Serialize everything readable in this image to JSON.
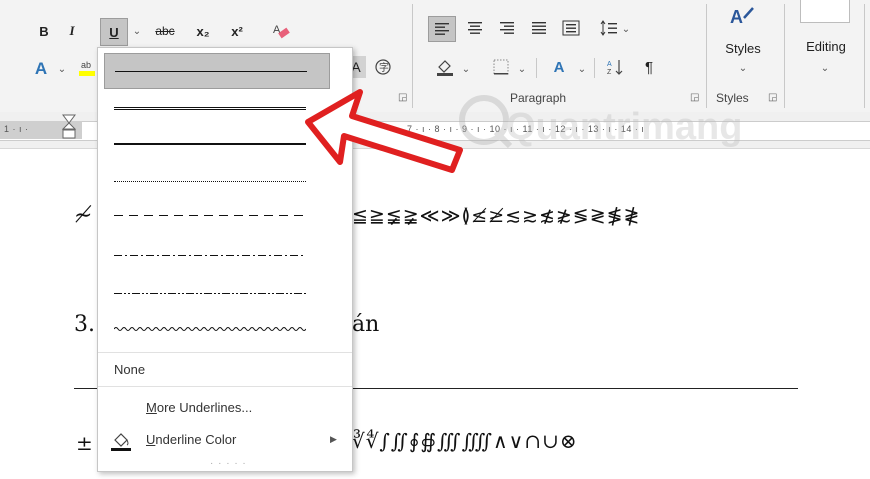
{
  "ribbon": {
    "font_buttons": {
      "bold": "B",
      "italic": "I",
      "underline": "U",
      "strikethrough": "abc",
      "subscript": "x₂",
      "superscript": "x²"
    },
    "right_buttons": {
      "styles": "Styles",
      "editing": "Editing"
    },
    "group_labels": {
      "paragraph": "Paragraph",
      "styles": "Styles"
    },
    "highlight_color": "#ffff00",
    "accent": "#2b579a"
  },
  "ruler": {
    "text": "1 · ı · 6 · ı · 7 · ı · 8 · ı · 9 · ı · 10 · ı · 11 · ı · 12 · ı · 13 · ı · 14 · ı"
  },
  "document": {
    "line1_prefix": "≁",
    "line1_symbols": "≦≧≨≩≪≫≬≰≱≲≳≴≵≶≷≸≹",
    "heading_prefix": "3.",
    "heading_suffix": "án",
    "line3_prefix": "±",
    "line3_symbols": "∛∜∫∬∮∯∭⨌∧∨∩∪⊗"
  },
  "underline_menu": {
    "none_label": "None",
    "more_label": "More Underlines...",
    "color_label": "Underline Color"
  },
  "annotation": {
    "arrow_color": "#e02020",
    "watermark_text": "Quantrimang"
  }
}
